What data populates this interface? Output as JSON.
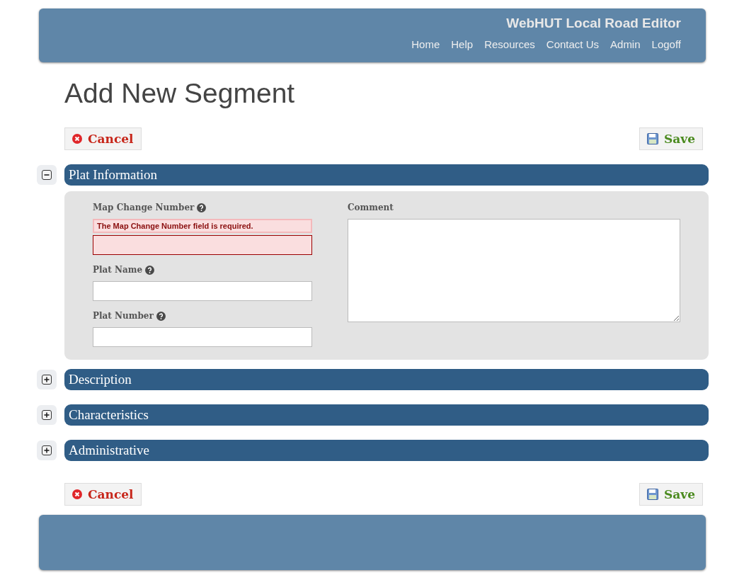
{
  "header": {
    "title": "WebHUT Local Road Editor",
    "nav": [
      "Home",
      "Help",
      "Resources",
      "Contact Us",
      "Admin",
      "Logoff"
    ]
  },
  "page_title": "Add New Segment",
  "actions_top": {
    "cancel": "Cancel",
    "save": "Save"
  },
  "sections": [
    {
      "title": "Plat Information",
      "expanded": true,
      "fields": [
        {
          "label": "Map Change Number",
          "help": true,
          "error": "The Map Change Number field is required."
        },
        {
          "label": "Plat Name",
          "help": true
        },
        {
          "label": "Plat Number",
          "help": true
        }
      ],
      "comment": {
        "label": "Comment"
      }
    },
    {
      "title": "Description",
      "expanded": false
    },
    {
      "title": "Characteristics",
      "expanded": false
    },
    {
      "title": "Administrative",
      "expanded": false
    }
  ],
  "actions_bottom": {
    "cancel": "Cancel",
    "save": "Save"
  }
}
